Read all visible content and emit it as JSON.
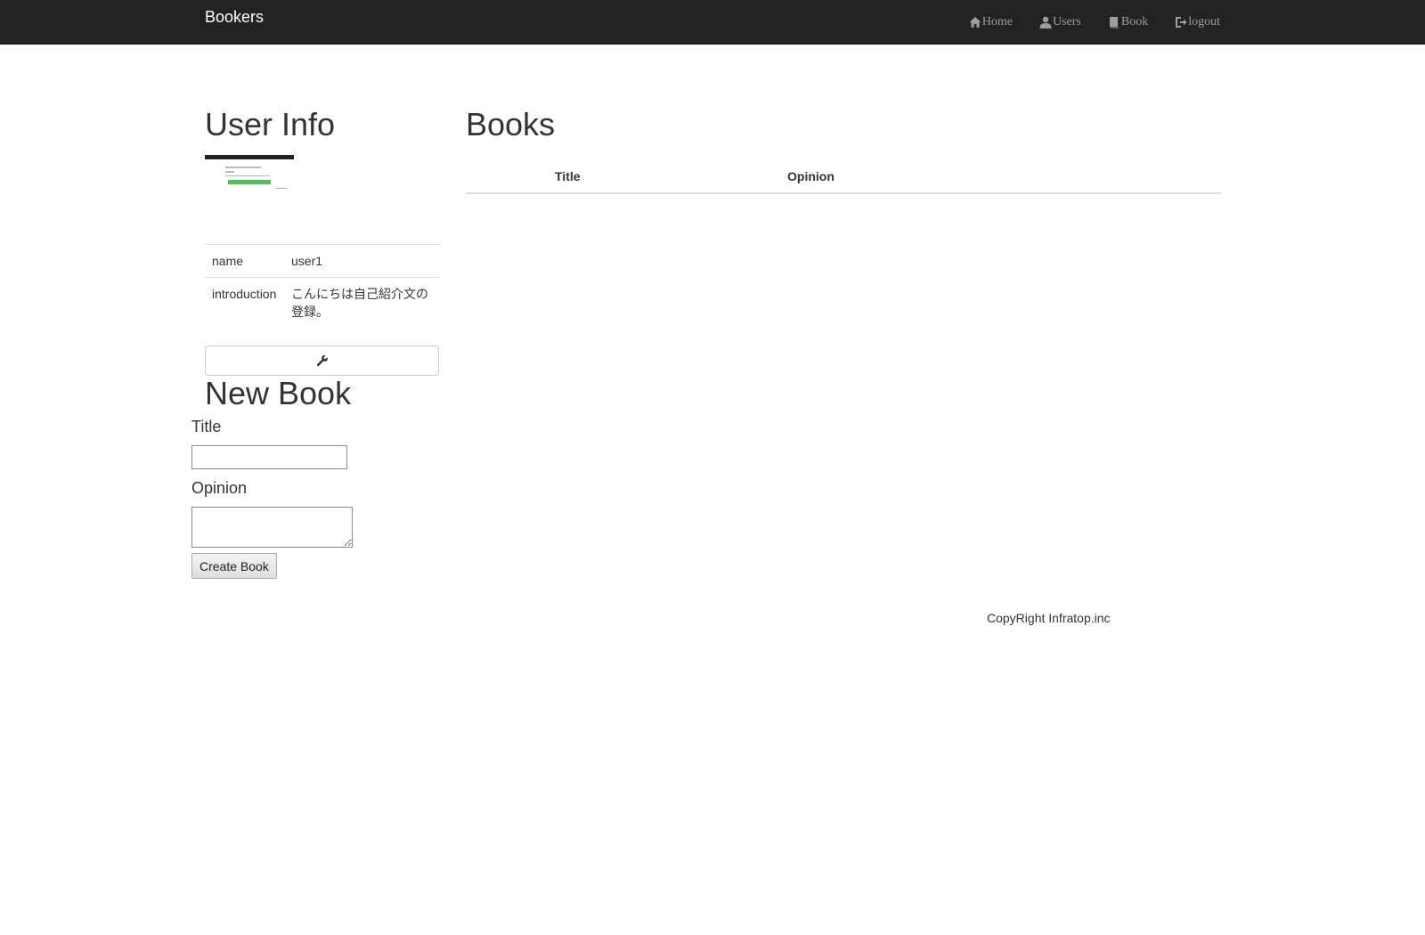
{
  "navbar": {
    "brand": "Bookers",
    "links": [
      {
        "label": "Home",
        "icon": "home-icon"
      },
      {
        "label": "Users",
        "icon": "user-icon"
      },
      {
        "label": "Book",
        "icon": "book-icon"
      },
      {
        "label": "logout",
        "icon": "logout-icon"
      }
    ]
  },
  "user_info": {
    "title": "User Info",
    "rows": [
      {
        "label": "name",
        "value": "user1"
      },
      {
        "label": "introduction",
        "value": "こんにちは自己紹介文の登録。"
      }
    ],
    "edit_icon": "wrench-icon"
  },
  "new_book": {
    "title": "New Book",
    "title_label": "Title",
    "opinion_label": "Opinion",
    "title_value": "",
    "opinion_value": "",
    "submit_label": "Create Book"
  },
  "books": {
    "title": "Books",
    "columns": [
      "",
      "Title",
      "Opinion"
    ]
  },
  "footer": {
    "text": "CopyRight Infratop.inc"
  }
}
